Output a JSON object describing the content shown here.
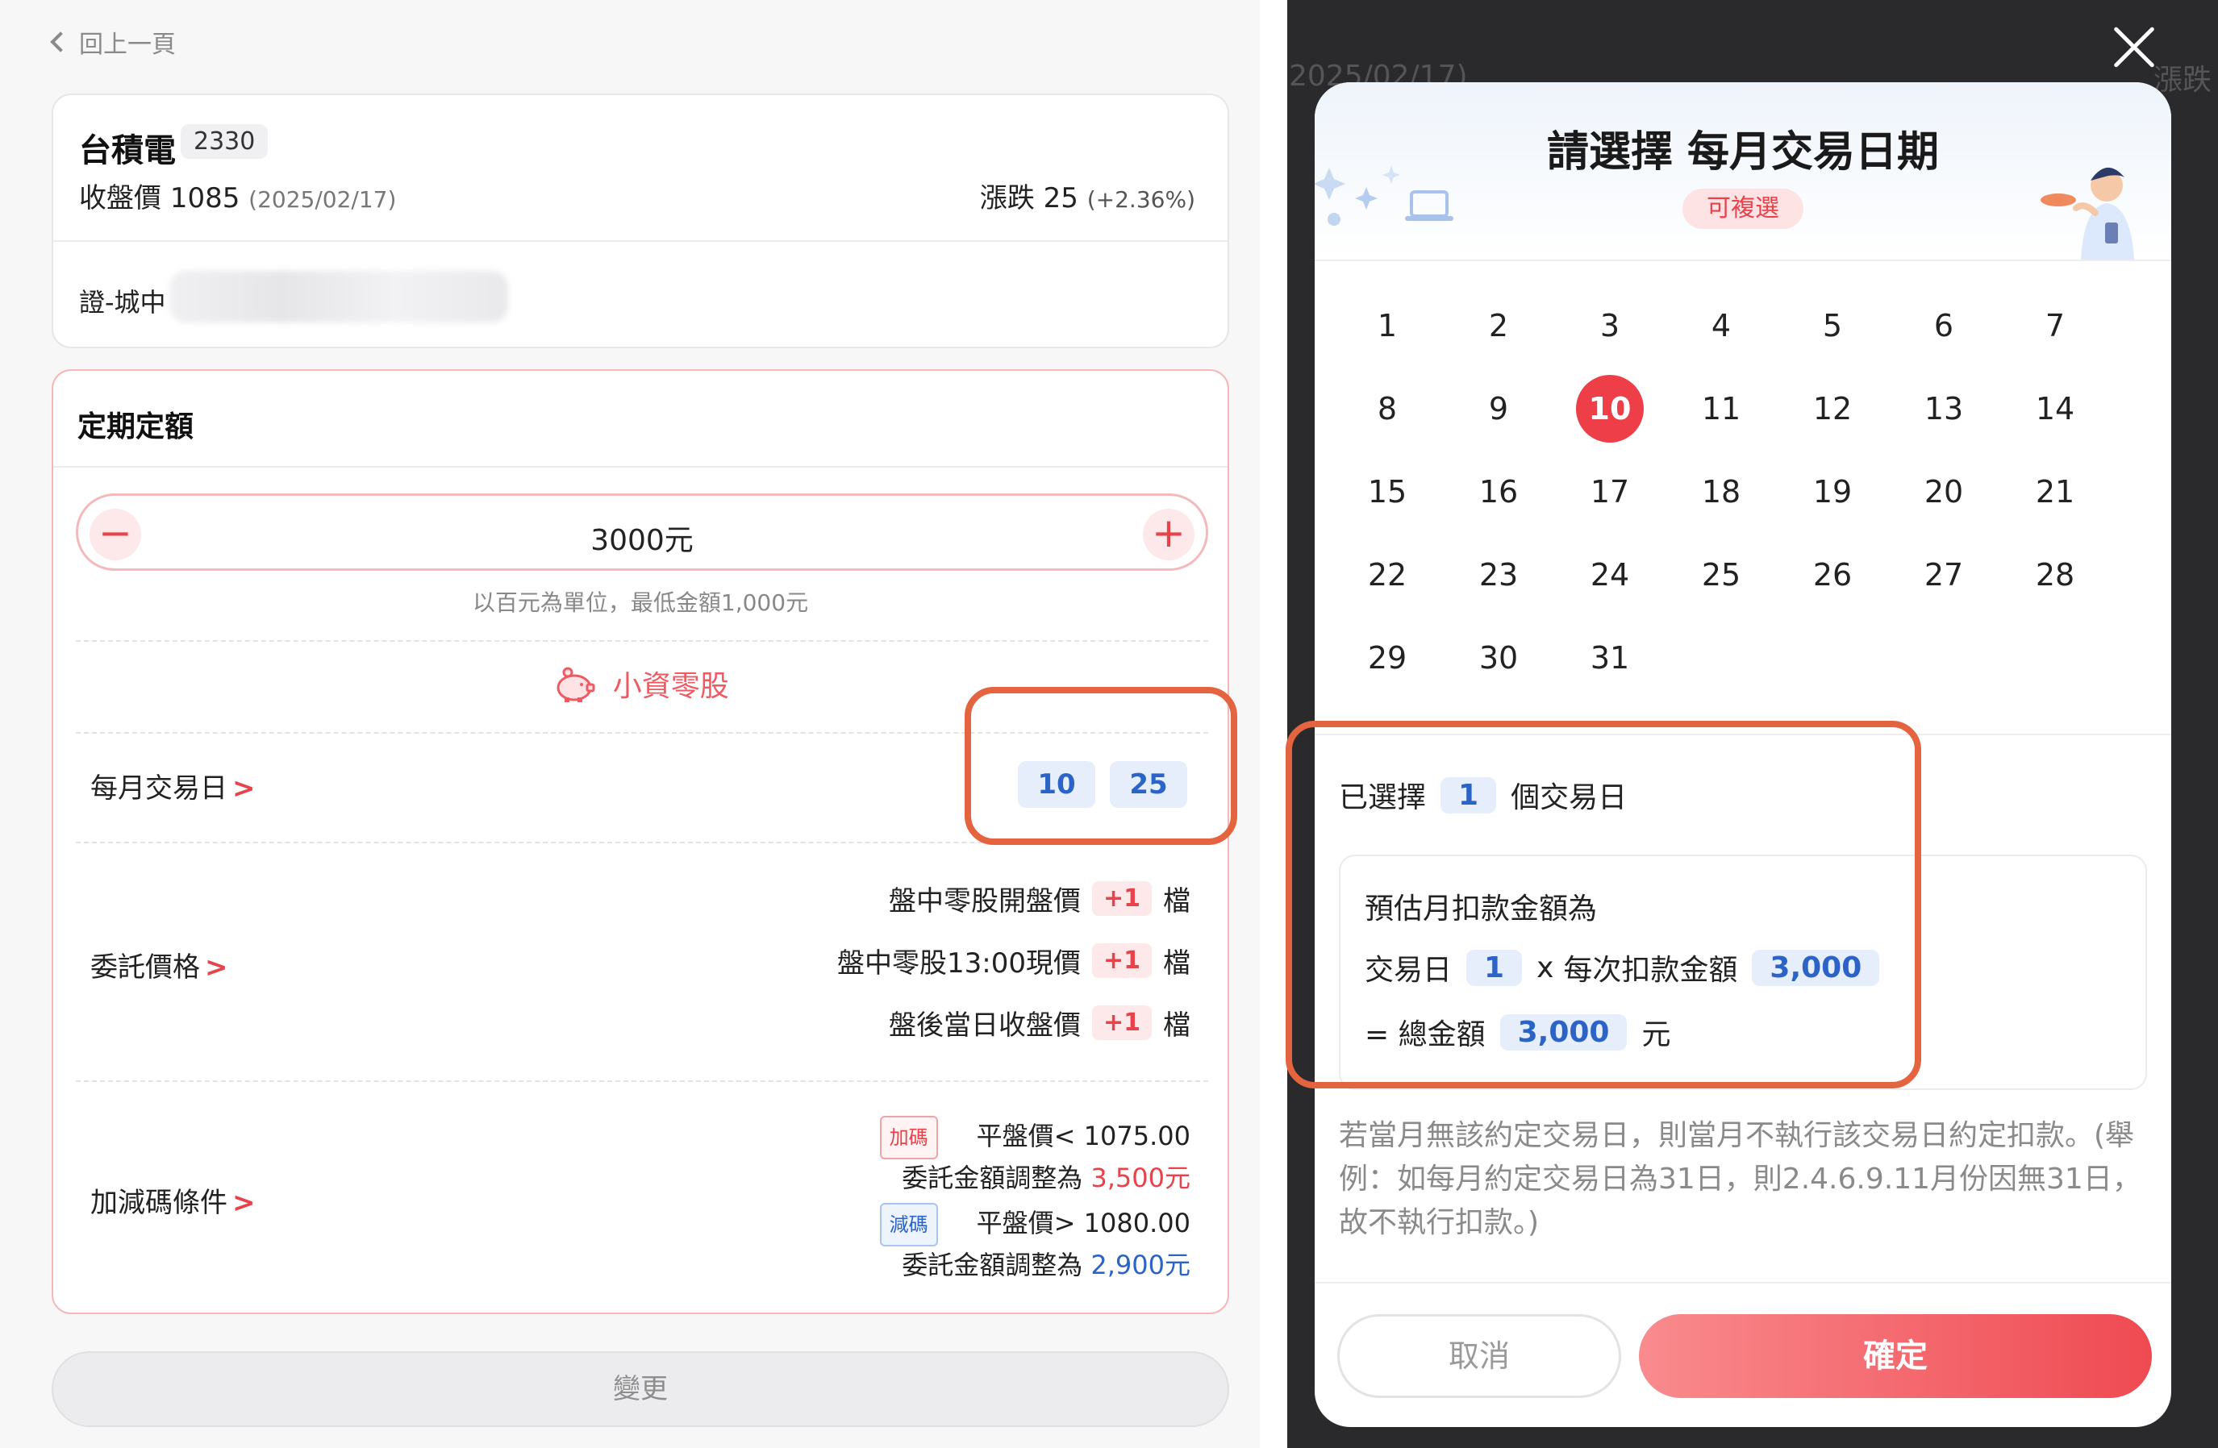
{
  "left": {
    "back_label": "回上一頁",
    "stock": {
      "name": "台積電",
      "code": "2330",
      "close_label": "收盤價",
      "close_value": "1085",
      "close_date": "(2025/02/17)",
      "change_label": "漲跌",
      "change_value": "25",
      "change_pct": "(+2.36%)",
      "account_label": "證-城中"
    },
    "plan": {
      "title": "定期定額",
      "amount": "3000元",
      "minus": "−",
      "plus": "+",
      "hint": "以百元為單位，最低金額1,000元",
      "brand": "小資零股",
      "monthly_day_label": "每月交易日",
      "arrow": ">",
      "days": [
        "10",
        "25"
      ],
      "order_price_label": "委託價格",
      "order_prices": [
        {
          "label": "盤中零股開盤價",
          "tick": "+1",
          "unit": "檔"
        },
        {
          "label": "盤中零股13:00現價",
          "tick": "+1",
          "unit": "檔"
        },
        {
          "label": "盤後當日收盤價",
          "tick": "+1",
          "unit": "檔"
        }
      ],
      "adjust_label": "加減碼條件",
      "adjust": [
        {
          "tag": "加碼",
          "cond": "平盤價< 1075.00",
          "amount_label": "委託金額調整為",
          "amount": "3,500元"
        },
        {
          "tag": "減碼",
          "cond": "平盤價> 1080.00",
          "amount_label": "委託金額調整為",
          "amount": "2,900元"
        }
      ]
    },
    "change_button": "變更"
  },
  "modal": {
    "title": "請選擇 每月交易日期",
    "subtitle": "可複選",
    "days": [
      "1",
      "2",
      "3",
      "4",
      "5",
      "6",
      "7",
      "8",
      "9",
      "10",
      "11",
      "12",
      "13",
      "14",
      "15",
      "16",
      "17",
      "18",
      "19",
      "20",
      "21",
      "22",
      "23",
      "24",
      "25",
      "26",
      "27",
      "28",
      "29",
      "30",
      "31"
    ],
    "selected_day": "10",
    "selected_prefix": "已選擇",
    "selected_count": "1",
    "selected_suffix": "個交易日",
    "estimate_title": "預估月扣款金額為",
    "estimate_days_label": "交易日",
    "estimate_days": "1",
    "estimate_times": "x",
    "estimate_per_label": "每次扣款金額",
    "estimate_per": "3,000",
    "estimate_total_label": "= 總金額",
    "estimate_total": "3,000",
    "estimate_unit": "元",
    "note": "若當月無該約定交易日，則當月不執行該交易日約定扣款。(舉例：如每月約定交易日為31日，則2.4.6.9.11月份因無31日，故不執行扣款。)",
    "cancel": "取消",
    "confirm": "確定"
  },
  "background": {
    "ghost_date": "2025/02/17)",
    "ghost_change": "漲跌"
  },
  "colors": {
    "accent_red": "#ee3f48",
    "accent_blue": "#2c63c6",
    "highlight": "#e4643f"
  }
}
